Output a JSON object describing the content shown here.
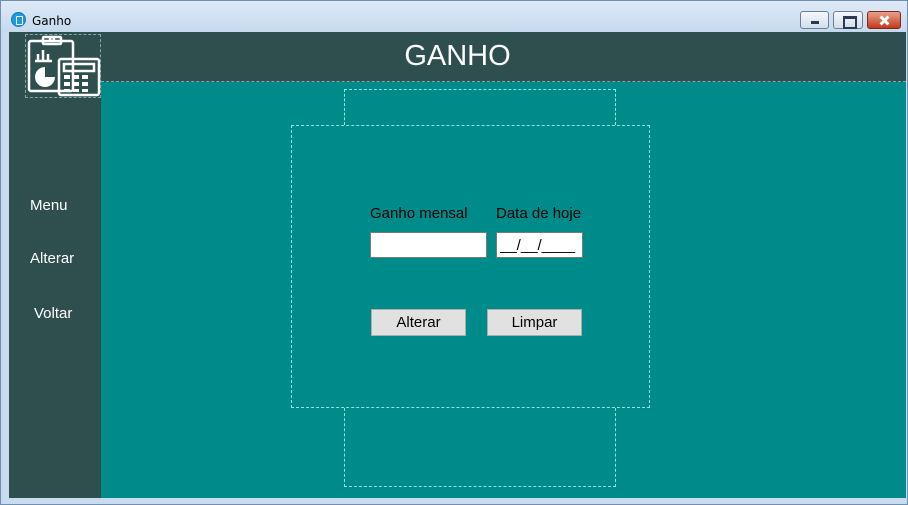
{
  "window": {
    "title": "Ganho",
    "app_icon": "clipboard-icon"
  },
  "header": {
    "title": "GANHO"
  },
  "sidebar": {
    "logo_icon": "clipboard-calculator-icon",
    "items": [
      {
        "label": "Menu"
      },
      {
        "label": "Alterar"
      },
      {
        "label": "Voltar"
      }
    ]
  },
  "form": {
    "ganho_label": "Ganho mensal",
    "ganho_value": "",
    "data_label": "Data de hoje",
    "data_value": "__/__/____"
  },
  "buttons": {
    "alterar_label": "Alterar",
    "limpar_label": "Limpar"
  },
  "colors": {
    "sidebar_header_bg": "#2f4f4f",
    "content_bg": "#008b8b",
    "text_light": "#ffffff"
  }
}
